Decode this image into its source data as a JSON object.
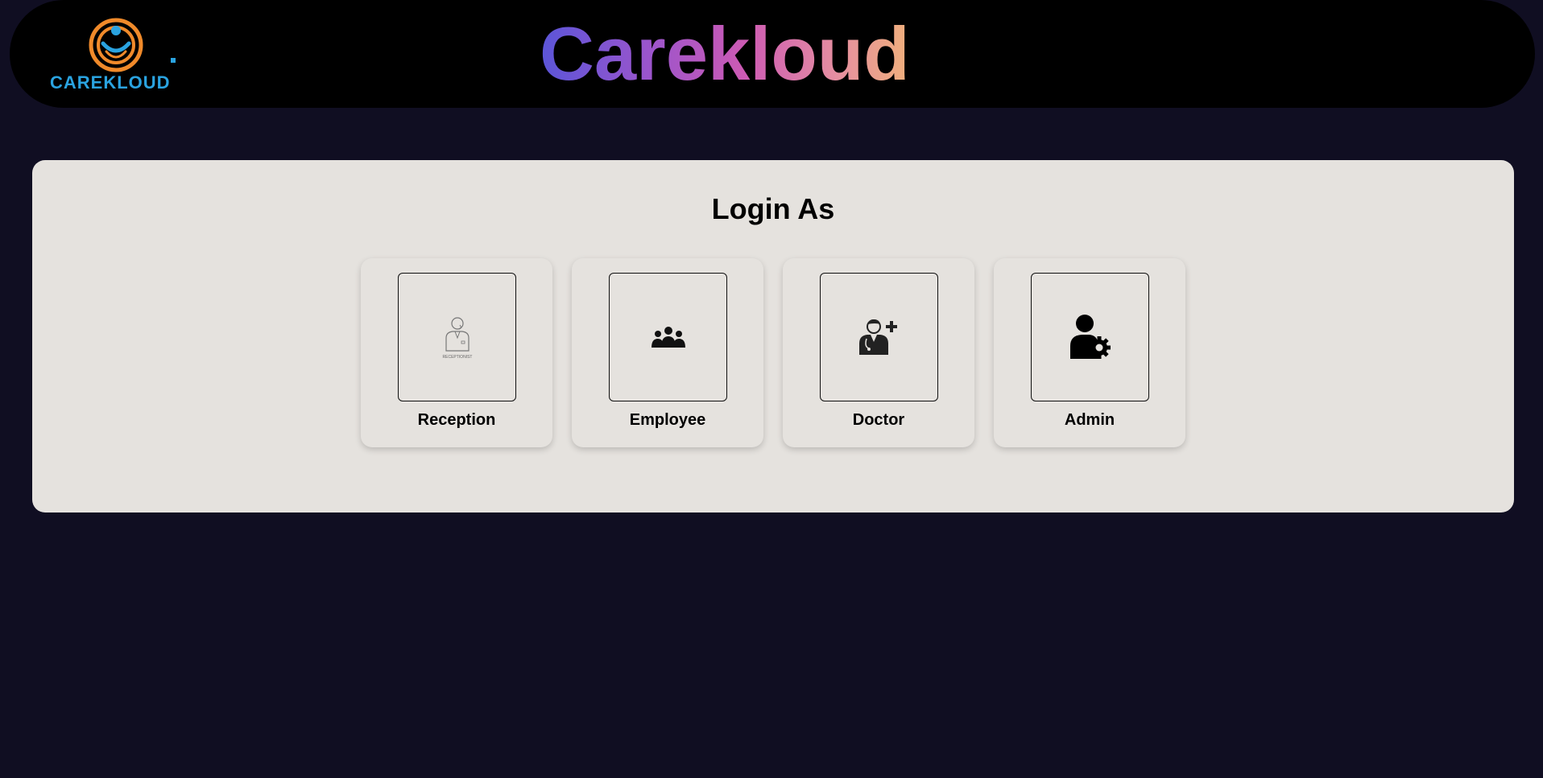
{
  "header": {
    "logo_text": "CAREKLOUD",
    "brand_title": "Carekloud"
  },
  "panel": {
    "title": "Login As",
    "roles": [
      {
        "label": "Reception",
        "icon": "receptionist-icon",
        "icon_caption": "RECEPTIONIST"
      },
      {
        "label": "Employee",
        "icon": "employees-group-icon"
      },
      {
        "label": "Doctor",
        "icon": "doctor-add-icon"
      },
      {
        "label": "Admin",
        "icon": "admin-gear-icon"
      }
    ]
  },
  "colors": {
    "background": "#100e22",
    "header": "#000000",
    "panel": "#e5e2de",
    "brand_gradient_start": "#5a55d8",
    "brand_gradient_end": "#f0b07c",
    "logo_orange": "#f08a2a",
    "logo_blue": "#2aa3e0"
  }
}
